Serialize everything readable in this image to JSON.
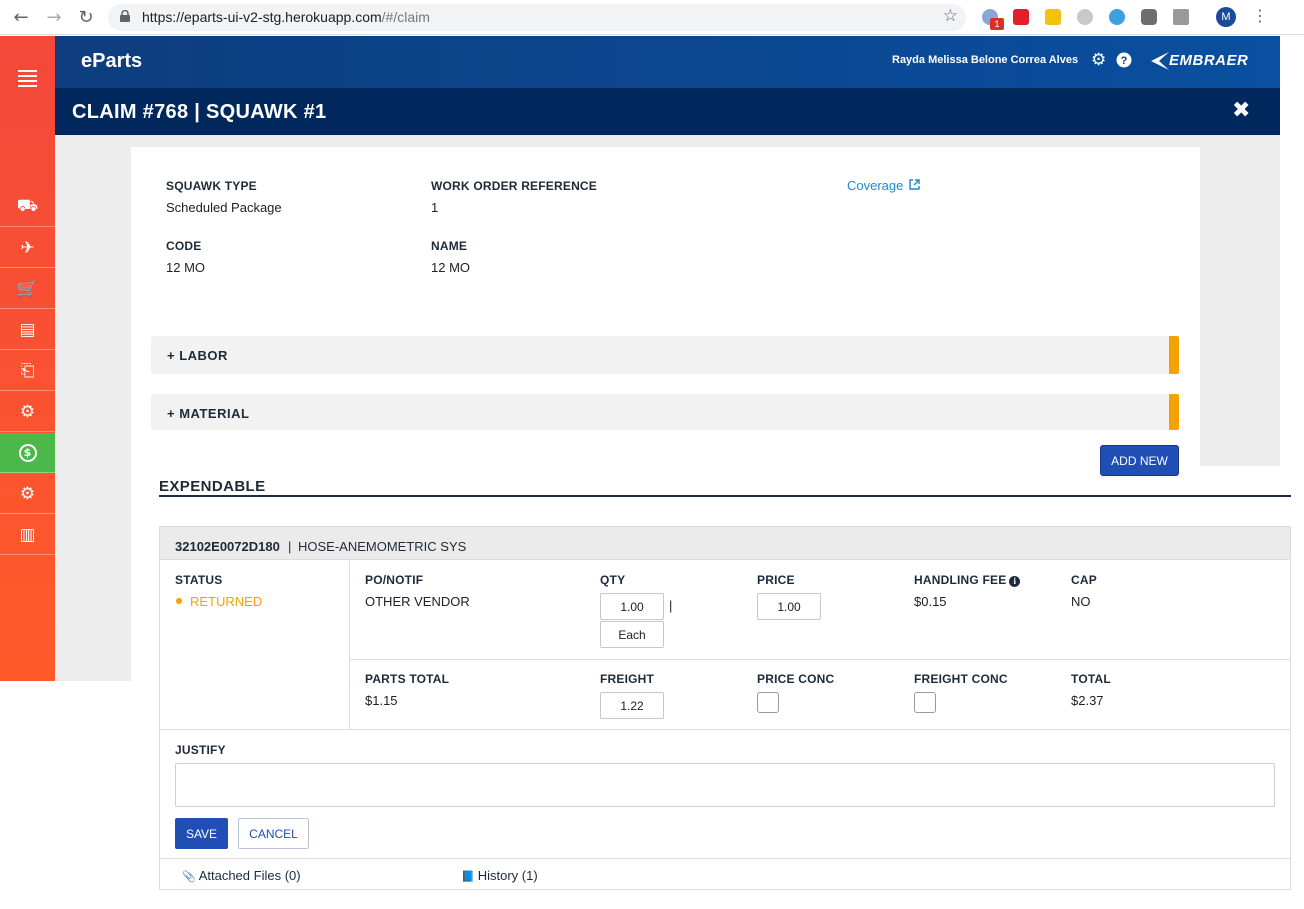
{
  "browser": {
    "url_host": "https://eparts-ui-v2-stg.herokuapp.com",
    "url_path": "/#/claim",
    "ext_badge": "1",
    "profile_initial": "M"
  },
  "header": {
    "brand": "eParts",
    "user_name": "Rayda Melissa Belone Correa Alves",
    "logo_text": "EMBRAER"
  },
  "title": "CLAIM #768 | SQUAWK #1",
  "sidebar": {
    "items": [
      {
        "icon": "truck-icon",
        "glyph": "⛟"
      },
      {
        "icon": "plane-icon",
        "glyph": "✈"
      },
      {
        "icon": "cart-icon",
        "glyph": "🛒"
      },
      {
        "icon": "document-icon",
        "glyph": "▤"
      },
      {
        "icon": "return-box-icon",
        "glyph": "⎗"
      },
      {
        "icon": "exchange-gears-icon",
        "glyph": "⚙"
      },
      {
        "icon": "money-icon",
        "glyph": "$",
        "active": true
      },
      {
        "icon": "settings-gears-icon",
        "glyph": "⚙"
      },
      {
        "icon": "bar-chart-icon",
        "glyph": "▥"
      }
    ],
    "active_color": "#4cb849"
  },
  "squawk": {
    "type_label": "SQUAWK TYPE",
    "type_value": "Scheduled Package",
    "wo_label": "WORK ORDER REFERENCE",
    "wo_value": "1",
    "coverage": "Coverage",
    "code_label": "CODE",
    "code_value": "12 MO",
    "name_label": "NAME",
    "name_value": "12 MO"
  },
  "sections": {
    "labor": "+ LABOR",
    "material": "+ MATERIAL",
    "add_new": "ADD NEW",
    "expendable": "EXPENDABLE"
  },
  "part": {
    "number": "32102E0072D180",
    "separator": "|",
    "description": "HOSE-ANEMOMETRIC SYS",
    "status_label": "STATUS",
    "status_value": "RETURNED",
    "status_color": "#f5a200",
    "po_label": "PO/NOTIF",
    "po_value": "OTHER VENDOR",
    "qty_label": "QTY",
    "qty_value": "1.00",
    "qty_sep": "|",
    "unit_value": "Each",
    "price_label": "PRICE",
    "price_value": "1.00",
    "handling_label": "HANDLING FEE",
    "handling_value": "$0.15",
    "cap_label": "CAP",
    "cap_value": "NO",
    "parts_total_label": "PARTS TOTAL",
    "parts_total_value": "$1.15",
    "freight_label": "FREIGHT",
    "freight_value": "1.22",
    "price_conc_label": "PRICE CONC",
    "freight_conc_label": "FREIGHT CONC",
    "total_label": "TOTAL",
    "total_value": "$2.37",
    "justify_label": "JUSTIFY",
    "save": "SAVE",
    "cancel": "CANCEL",
    "attached_files": "Attached Files (0)",
    "history": "History (1)"
  }
}
